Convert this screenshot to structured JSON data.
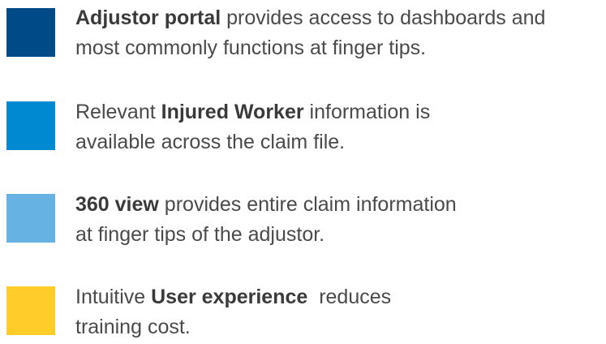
{
  "features": [
    {
      "color": "#004b87",
      "line1_bold": "Adjustor portal",
      "line1_rest": " provides access to dashboards and",
      "line2": "most commonly functions at finger tips."
    },
    {
      "color": "#0088d1",
      "line1_pre": "Relevant ",
      "line1_bold": "Injured Worker",
      "line1_rest": " information is",
      "line2": "available across the claim file."
    },
    {
      "color": "#66b3e3",
      "line1_bold": "360 view",
      "line1_rest": " provides entire claim information",
      "line2": "at finger tips of the adjustor."
    },
    {
      "color": "#ffcc29",
      "line1_pre": "Intuitive ",
      "line1_bold": "User experience",
      "line1_rest": "  reduces",
      "line2": "training cost."
    }
  ]
}
